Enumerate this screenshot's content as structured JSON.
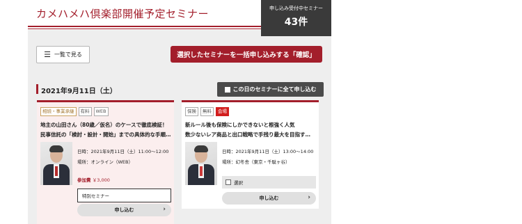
{
  "header": {
    "title": "カメハメハ倶楽部開催予定セミナー",
    "count_label": "申し込み受付中セミナー",
    "count_value": "43件"
  },
  "toolbar": {
    "list_label": "一覧で見る",
    "bulk_apply_label": "選択したセミナーを一括申し込みする「確認」"
  },
  "date_group": {
    "date": "2021年9月11日（土）",
    "apply_all_label": "この日のセミナーに全て申し込む"
  },
  "cards": [
    {
      "tags": [
        "相続・事業承継",
        "有料",
        "WEB"
      ],
      "title_line1": "地主の山田さん（80歳／仮名）のケースで徹底検証！",
      "title_line2": "民事信託の「検討・設計・開始」までの具体的な手順…",
      "datetime": "日時：2021年9月11日（土）11:00～12:00",
      "venue": "場所：オンライン（WEB）",
      "fee_label": "参加費",
      "fee_value": "￥3,000",
      "seminar_type": "特別セミナー",
      "apply_label": "申し込む"
    },
    {
      "tags": [
        "保険",
        "無料",
        "会場"
      ],
      "title_line1": "新ルール後も保険にしかできないと根強く人気",
      "title_line2": "数少ないレア商品と出口戦略で手残り最大を目指す…",
      "datetime": "日時：2021年9月11日（土）13:00～14:00",
      "venue": "場所：幻冬舎（東京・千駄ヶ谷）",
      "select_label": "選択",
      "apply_label": "申し込む"
    }
  ],
  "colors": {
    "accent": "#a31e2b",
    "dark_box": "#3a3a3a",
    "page_bg": "#eeeeee"
  },
  "icons": {
    "list": "menu-icon",
    "arrow": "chevron-right-icon",
    "checkbox": "checkbox-icon"
  }
}
